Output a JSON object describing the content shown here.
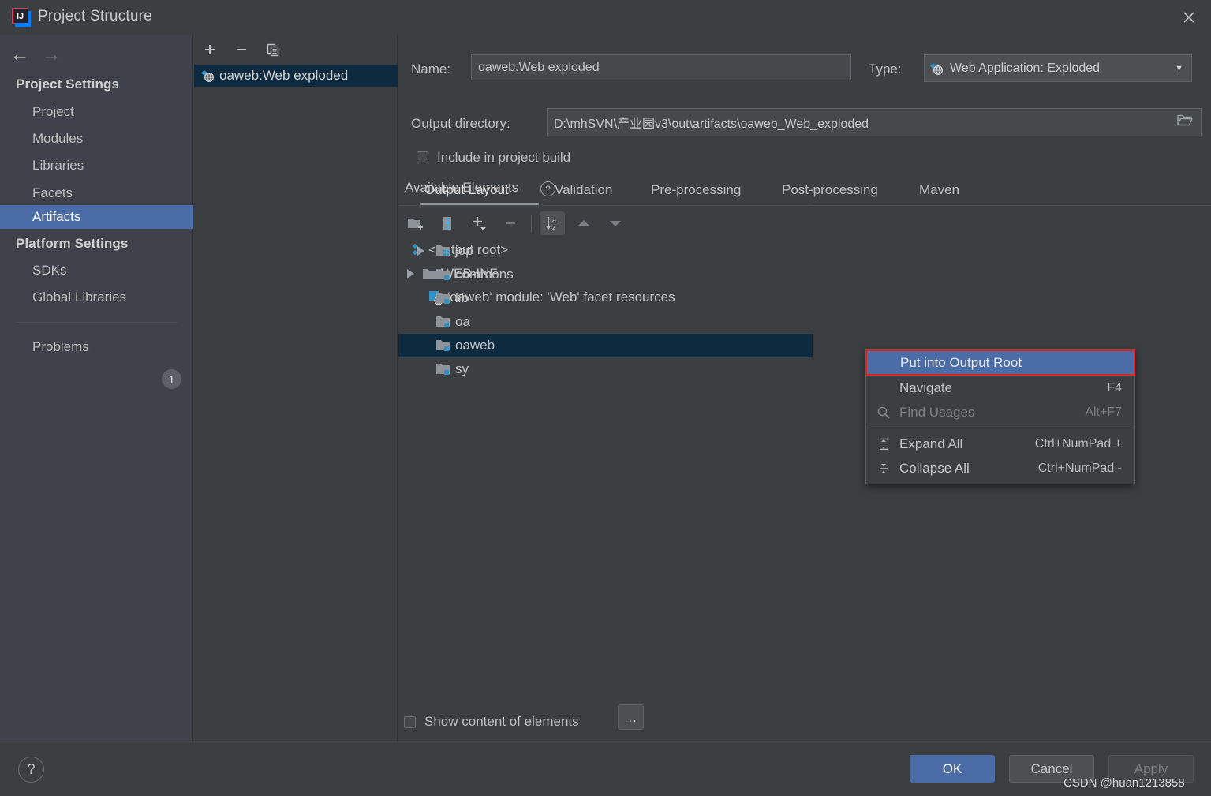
{
  "window": {
    "title": "Project Structure",
    "logo_icon": "intellij-idea-logo",
    "close_icon": "close-icon"
  },
  "sidebar": {
    "nav_back_icon": "arrow-left-icon",
    "nav_forward_icon": "arrow-right-icon",
    "groups": [
      {
        "title": "Project Settings",
        "items": [
          {
            "label": "Project",
            "selected": false
          },
          {
            "label": "Modules",
            "selected": false
          },
          {
            "label": "Libraries",
            "selected": false
          },
          {
            "label": "Facets",
            "selected": false
          },
          {
            "label": "Artifacts",
            "selected": true
          }
        ]
      },
      {
        "title": "Platform Settings",
        "items": [
          {
            "label": "SDKs",
            "selected": false
          },
          {
            "label": "Global Libraries",
            "selected": false
          }
        ]
      }
    ],
    "problems": {
      "label": "Problems",
      "count": "1"
    }
  },
  "artifacts_panel": {
    "toolbar": [
      {
        "name": "add-artifact-button",
        "icon": "plus-icon"
      },
      {
        "name": "remove-artifact-button",
        "icon": "minus-icon"
      },
      {
        "name": "copy-artifact-button",
        "icon": "copy-icon"
      }
    ],
    "items": [
      {
        "label": "oaweb:Web exploded",
        "icon": "web-artifact-icon",
        "selected": true
      }
    ]
  },
  "form": {
    "name_label": "Name:",
    "name_value": "oaweb:Web exploded",
    "type_label": "Type:",
    "type_value": "Web Application: Exploded",
    "type_icon": "web-artifact-icon",
    "type_dropdown_icon": "chevron-down-icon",
    "output_dir_label": "Output directory:",
    "output_dir_value": "D:\\mhSVN\\产业园v3\\out\\artifacts\\oaweb_Web_exploded",
    "browse_icon": "folder-open-icon",
    "include_in_build_label": "Include in project build",
    "include_in_build_checked": false
  },
  "tabs": [
    {
      "label": "Output Layout",
      "active": true
    },
    {
      "label": "Validation",
      "active": false
    },
    {
      "label": "Pre-processing",
      "active": false
    },
    {
      "label": "Post-processing",
      "active": false
    },
    {
      "label": "Maven",
      "active": false
    }
  ],
  "output_layout": {
    "toolbar": [
      {
        "name": "create-directory-button",
        "icon": "new-folder-icon",
        "active": false
      },
      {
        "name": "create-archive-button",
        "icon": "archive-icon",
        "active": false
      },
      {
        "name": "add-copy-of-button",
        "icon": "plus-dropdown-icon",
        "active": false
      },
      {
        "name": "remove-element-button",
        "icon": "minus-icon",
        "active": false
      },
      {
        "name": "sort-elements-button",
        "icon": "sort-az-icon",
        "active": true
      },
      {
        "name": "move-up-button",
        "icon": "arrow-up-icon",
        "active": false
      },
      {
        "name": "move-down-button",
        "icon": "arrow-down-icon",
        "active": false
      }
    ],
    "tree": [
      {
        "label": "<output root>",
        "icon": "output-root-icon",
        "indent": 0,
        "expander": "none"
      },
      {
        "label": "WEB-INF",
        "icon": "folder-icon",
        "indent": 0,
        "expander": "collapsed"
      },
      {
        "label": "'oaweb' module: 'Web' facet resources",
        "icon": "facet-resources-icon",
        "indent": 1,
        "expander": "none"
      }
    ]
  },
  "available_elements": {
    "title": "Available Elements",
    "help_icon": "help-circle-icon",
    "help_glyph": "?",
    "items": [
      {
        "label": "jop",
        "icon": "module-group-icon",
        "expander": "collapsed",
        "selected": false
      },
      {
        "label": "commons",
        "icon": "module-icon",
        "expander": "none",
        "selected": false
      },
      {
        "label": "lib",
        "icon": "module-icon",
        "expander": "none",
        "selected": false
      },
      {
        "label": "oa",
        "icon": "module-icon",
        "expander": "none",
        "selected": false
      },
      {
        "label": "oaweb",
        "icon": "module-icon",
        "expander": "none",
        "selected": true
      },
      {
        "label": "sy",
        "icon": "module-icon",
        "expander": "none",
        "selected": false
      }
    ]
  },
  "context_menu": {
    "items": [
      {
        "label": "Put into Output Root",
        "shortcut": "",
        "icon": "",
        "highlighted": true,
        "disabled": false
      },
      {
        "label": "Navigate",
        "shortcut": "F4",
        "icon": "",
        "highlighted": false,
        "disabled": false
      },
      {
        "label": "Find Usages",
        "shortcut": "Alt+F7",
        "icon": "search-icon",
        "highlighted": false,
        "disabled": true
      },
      {
        "label": "Expand All",
        "shortcut": "Ctrl+NumPad +",
        "icon": "expand-all-icon",
        "highlighted": false,
        "disabled": false
      },
      {
        "label": "Collapse All",
        "shortcut": "Ctrl+NumPad -",
        "icon": "collapse-all-icon",
        "highlighted": false,
        "disabled": false
      }
    ]
  },
  "bottom": {
    "show_content_label": "Show content of elements",
    "show_content_checked": false,
    "dots_button_label": "...",
    "help_button_glyph": "?",
    "ok_label": "OK",
    "cancel_label": "Cancel",
    "apply_label": "Apply"
  },
  "watermark": "CSDN @huan1213858",
  "colors": {
    "background": "#3c3f41",
    "sidebar_background": "#3f424b",
    "accent_blue": "#4a6da7",
    "tree_selection": "#0e2a3f",
    "highlight_border_red": "#e2231a",
    "field_background": "#45494a"
  }
}
